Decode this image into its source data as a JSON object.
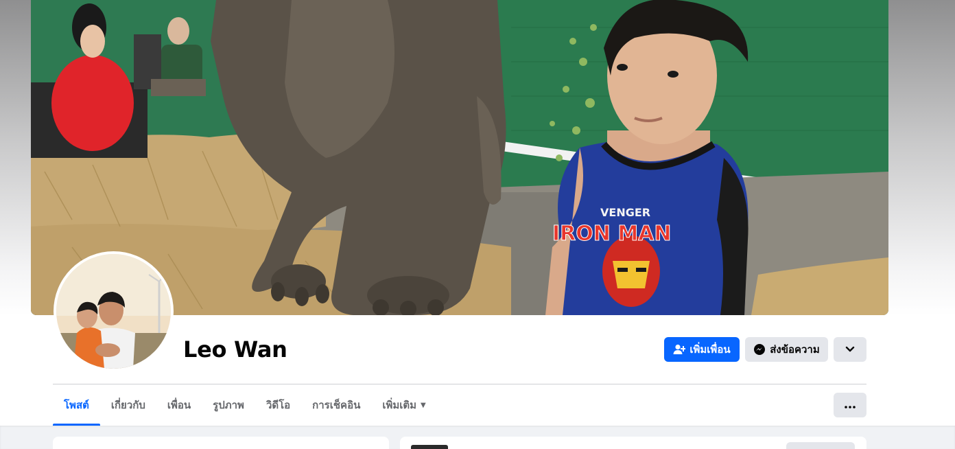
{
  "profile": {
    "name": "Leo Wan"
  },
  "actions": {
    "add_friend_label": "เพิ่มเพื่อน",
    "message_label": "ส่งข้อความ"
  },
  "tabs": [
    {
      "label": "โพสต์",
      "active": true
    },
    {
      "label": "เกี่ยวกับ",
      "active": false
    },
    {
      "label": "เพื่อน",
      "active": false
    },
    {
      "label": "รูปภาพ",
      "active": false
    },
    {
      "label": "วิดีโอ",
      "active": false
    },
    {
      "label": "การเช็คอิน",
      "active": false
    },
    {
      "label": "เพิ่มเติม",
      "active": false
    }
  ],
  "cover_text": {
    "shirt_line1": "VENGER",
    "shirt_line2": "IRON MAN"
  },
  "colors": {
    "accent": "#0866ff",
    "secondary_button": "#e4e6eb",
    "text_primary": "#050505",
    "text_secondary": "#65676b",
    "page_background": "#f0f2f5"
  },
  "icons": {
    "add_friend": "person-plus-icon",
    "message": "messenger-icon",
    "more": "chevron-down-icon",
    "options": "ellipsis-icon",
    "tab_more": "caret-down-icon"
  }
}
